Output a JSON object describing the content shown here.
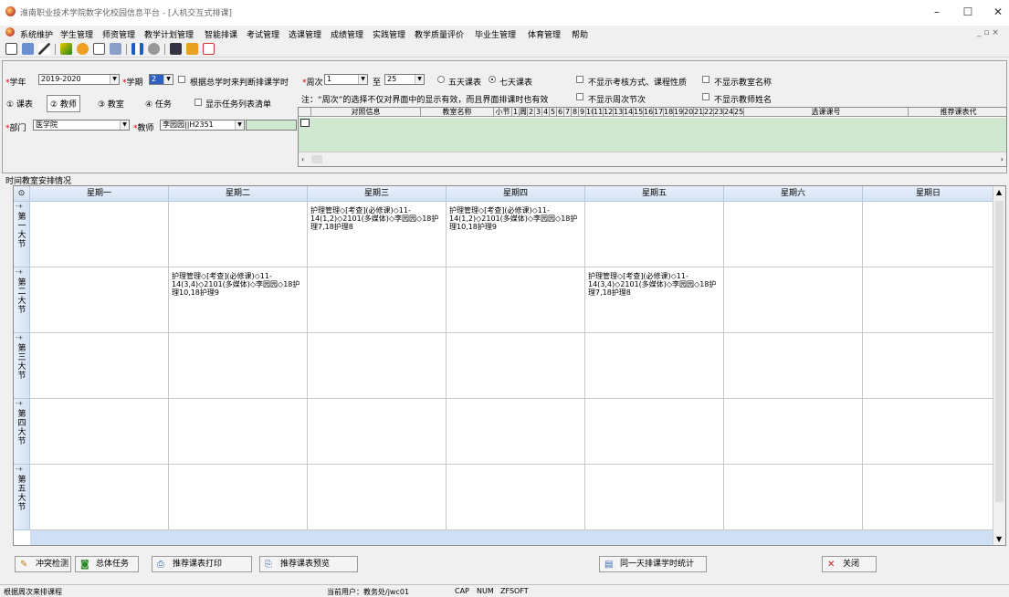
{
  "window": {
    "title": "淮南职业技术学院数字化校园信息平台 - [人机交互式排课]"
  },
  "menu": [
    "系统维护",
    "学生管理",
    "师资管理",
    "教学计划管理",
    "智能排课",
    "考试管理",
    "选课管理",
    "成绩管理",
    "实践管理",
    "教学质量评价",
    "毕业生管理",
    "体育管理",
    "帮助"
  ],
  "form": {
    "year_label": "学年",
    "year_value": "2019-2020",
    "term_label": "学期",
    "term_value": "2",
    "check_total_hours": "根据总学时来判断排课学时",
    "week_label": "周次",
    "week_from": "1",
    "to_label": "至",
    "week_to": "25",
    "radio_five": "五天课表",
    "radio_seven": "七天课表",
    "note": "注：“周次”的选择不仅对界面中的显示有效，而且界面排课时也有效",
    "chk_no_exam": "不显示考核方式、课程性质",
    "chk_no_room": "不显示教室名称",
    "chk_no_week": "不显示周次节次",
    "chk_no_teacher": "不显示教师姓名",
    "tab_schedule": "① 课表",
    "tab_teacher": "② 教师",
    "tab_room": "③ 教室",
    "tab_task": "④ 任务",
    "chk_task_list": "显示任务列表清单",
    "dept_label": "部门",
    "dept_value": "医学院",
    "teacher_label": "教师",
    "teacher_value": "李园园||H2351"
  },
  "grid2": {
    "headers": [
      "对照信息",
      "教室名称",
      "小节",
      "1",
      "周",
      "2",
      "3",
      "4",
      "5",
      "6",
      "7",
      "8",
      "9",
      "10",
      "11",
      "12",
      "13",
      "14",
      "15",
      "16",
      "17",
      "18",
      "19",
      "20",
      "21",
      "22",
      "23",
      "24",
      "25",
      "选课课号",
      "推荐课表代"
    ]
  },
  "schedule": {
    "section_title": "时间教室安排情况",
    "corner": "⊙",
    "days": [
      "星期一",
      "星期二",
      "星期三",
      "星期四",
      "星期五",
      "星期六",
      "星期日"
    ],
    "periods": [
      "第一大节",
      "第二大节",
      "第三大节",
      "第四大节",
      "第五大节"
    ],
    "cells": [
      [
        "",
        "",
        "护理管理◇[考查](必修课)◇11-14(1,2)◇2101(多媒体)◇李园园◇18护理7,18护理8",
        "护理管理◇[考查](必修课)◇11-14(1,2)◇2101(多媒体)◇李园园◇18护理10,18护理9",
        "",
        "",
        ""
      ],
      [
        "",
        "护理管理◇[考查](必修课)◇11-14(3,4)◇2101(多媒体)◇李园园◇18护理10,18护理9",
        "",
        "",
        "护理管理◇[考查](必修课)◇11-14(3,4)◇2101(多媒体)◇李园园◇18护理7,18护理8",
        "",
        ""
      ],
      [
        "",
        "",
        "",
        "",
        "",
        "",
        ""
      ],
      [
        "",
        "",
        "",
        "",
        "",
        "",
        ""
      ],
      [
        "",
        "",
        "",
        "",
        "",
        "",
        ""
      ]
    ]
  },
  "buttons": {
    "conflict": "冲突检测",
    "total": "总体任务",
    "print": "推荐课表打印",
    "preview": "推荐课表预览",
    "stat": "同一天排课学时统计",
    "close": "关闭"
  },
  "status": {
    "left": "根据周次来排课程",
    "user": "当前用户：教务处/jwc01",
    "caps": "CAP",
    "num": "NUM",
    "sys": "ZFSOFT"
  }
}
